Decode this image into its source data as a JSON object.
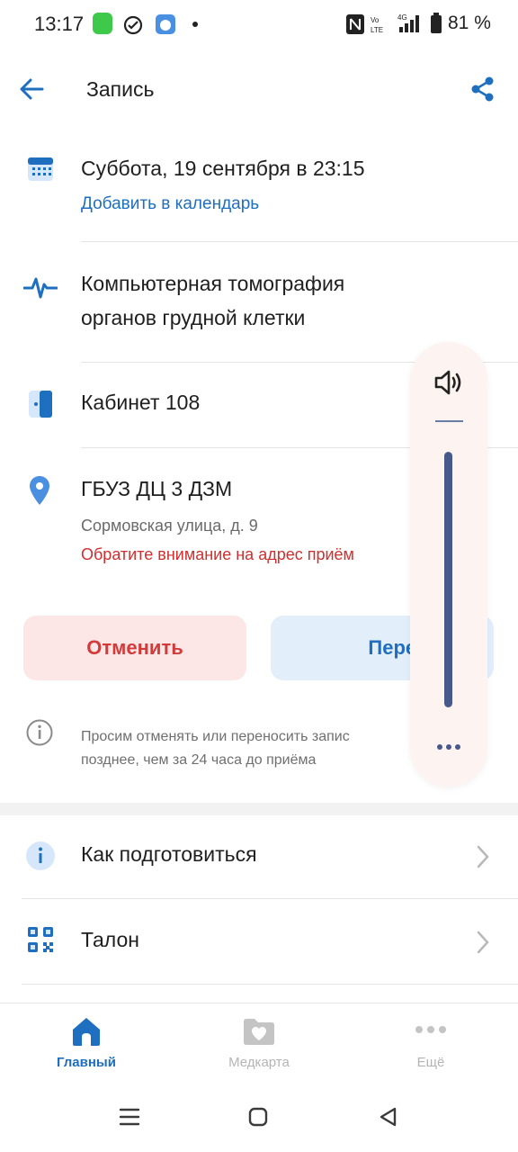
{
  "status_bar": {
    "time": "13:17",
    "battery": "81 %",
    "network": "4G"
  },
  "header": {
    "title": "Запись"
  },
  "appointment": {
    "date_text": "Суббота, 19 сентября в 23:15",
    "add_calendar": "Добавить в календарь",
    "service_line1": "Компьютерная томография",
    "service_line2": "органов грудной клетки",
    "cabinet": "Кабинет 108",
    "clinic_name": "ГБУЗ ДЦ 3 ДЗМ",
    "address": "Сормовская улица, д. 9",
    "address_warning": "Обратите внимание на адрес приём"
  },
  "actions": {
    "cancel_label": "Отменить",
    "reschedule_label": "Перенес"
  },
  "notice": {
    "line1": "Просим отменять или переносить запис",
    "line2": "позднее, чем за 24 часа до приёма"
  },
  "menu": {
    "prepare": "Как подготовиться",
    "ticket": "Талон"
  },
  "bottom_nav": {
    "home": "Главный",
    "medcard": "Медкарта",
    "more": "Ещё"
  },
  "colors": {
    "accent": "#1e6fbf",
    "danger": "#d43a3a",
    "volume_track": "#46598a"
  },
  "volume": {
    "level": 1.0
  }
}
